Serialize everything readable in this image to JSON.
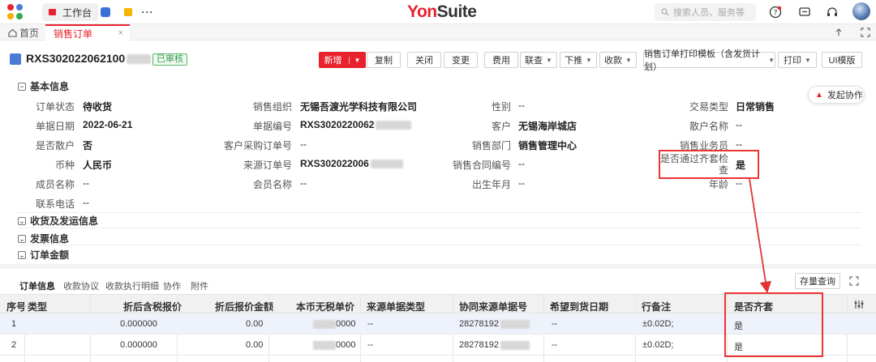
{
  "topbar": {
    "workbench_label": "工作台",
    "more_label": "···",
    "brand_prefix": "Yon",
    "brand_suffix": "Suite",
    "search_placeholder": "搜索人员、服务等"
  },
  "tabs": {
    "home_label": "首页",
    "current_label": "销售订单",
    "close_glyph": "×"
  },
  "header": {
    "doc_number_prefix": "RXS302022062100",
    "status_badge": "已审核",
    "buttons": {
      "new": "新增",
      "copy": "复制",
      "close": "关闭",
      "change": "变更",
      "fee": "费用",
      "link_query": "联查",
      "push_down": "下推",
      "receipt": "收款",
      "print_template": "销售订单打印模板（含发货计划）",
      "print": "打印",
      "ui_template": "UI模版"
    }
  },
  "sections": {
    "basic": "基本信息",
    "shipping": "收货及发运信息",
    "invoice": "发票信息",
    "amount": "订单金额"
  },
  "float_button": "发起协作",
  "basic_info": {
    "order_status_label": "订单状态",
    "order_status": "待收货",
    "sales_org_label": "销售组织",
    "sales_org": "无锡吾渡光学科技有限公司",
    "gender_label": "性别",
    "gender": "--",
    "trade_type_label": "交易类型",
    "trade_type": "日常销售",
    "doc_date_label": "单据日期",
    "doc_date": "2022-06-21",
    "doc_no_label": "单据编号",
    "doc_no": "RXS3020220062",
    "customer_label": "客户",
    "customer": "无锡海岸城店",
    "walkin_name_label": "散户名称",
    "walkin_name": "--",
    "is_walkin_label": "是否散户",
    "is_walkin": "否",
    "customer_po_label": "客户采购订单号",
    "customer_po": "--",
    "sales_dept_label": "销售部门",
    "sales_dept": "销售管理中心",
    "salesperson_label": "销售业务员",
    "salesperson": "--",
    "currency_label": "币种",
    "currency": "人民币",
    "source_order_label": "来源订单号",
    "source_order": "RXS302022006",
    "contract_no_label": "销售合同编号",
    "contract_no": "--",
    "kit_check_label_1": "是否通过齐套检",
    "kit_check_label_2": "查",
    "kit_check": "是",
    "member_name_label": "成员名称",
    "member_name": "--",
    "vip_name_label": "会员名称",
    "vip_name": "--",
    "birth_label": "出生年月",
    "birth": "--",
    "age_label": "年龄",
    "age": "--",
    "phone_label": "联系电话",
    "phone": "--"
  },
  "subtabs": {
    "order_info": "订单信息",
    "payment_terms": "收款协议",
    "payment_detail": "收款执行明细",
    "collaboration": "协作",
    "attachment": "附件",
    "stock_query": "存量查询"
  },
  "grid": {
    "columns": {
      "seq": "序号",
      "type": "类型",
      "disc_tax_price": "折后含税报价",
      "disc_amount": "折后报价金额",
      "base_price": "本币无税单价",
      "source_type": "来源单据类型",
      "collab_no": "协同来源单据号",
      "expected_date": "希望到货日期",
      "line_note": "行备注",
      "is_kit": "是否齐套"
    },
    "rows": [
      {
        "seq": "1",
        "disc_tax_price": "0.000000",
        "disc_amount": "0.00",
        "base_price_suffix": "0000",
        "source_type": "--",
        "collab_no": "28278192",
        "expected_date": "--",
        "line_note": "±0.02D;",
        "is_kit": "是"
      },
      {
        "seq": "2",
        "disc_tax_price": "0.000000",
        "disc_amount": "0.00",
        "base_price_suffix": "0000",
        "source_type": "--",
        "collab_no": "28278192",
        "expected_date": "--",
        "line_note": "±0.02D;",
        "is_kit": "是"
      }
    ]
  },
  "colors": {
    "accent": "#e8222d",
    "badge_green": "#3a9c4f",
    "annotation_red": "#e33333"
  }
}
